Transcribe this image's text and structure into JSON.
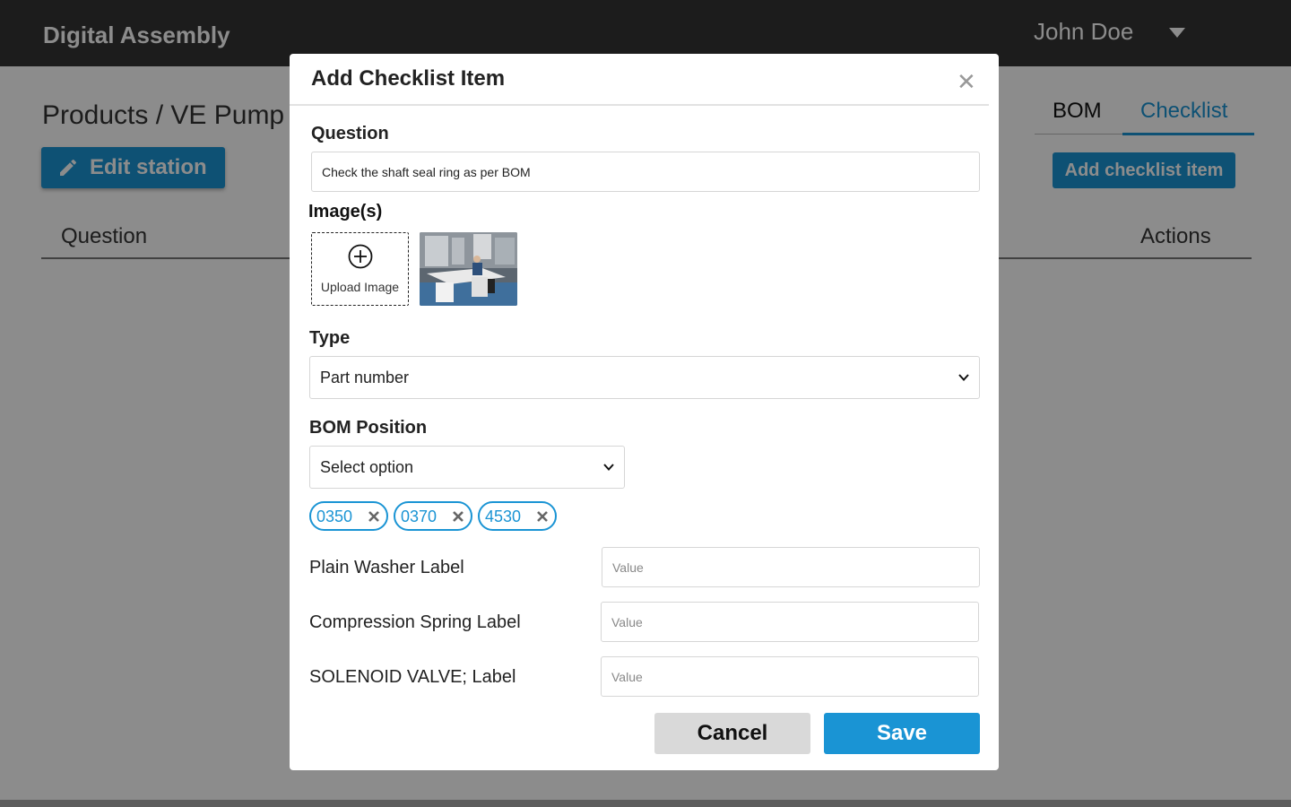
{
  "app": {
    "title": "Digital Assembly",
    "user_name": "John Doe"
  },
  "page": {
    "breadcrumb": "Products / VE Pump",
    "edit_station_label": "Edit station",
    "tabs": [
      {
        "label": "BOM",
        "active": false
      },
      {
        "label": "Checklist",
        "active": true
      }
    ],
    "add_checklist_item_label": "Add checklist item",
    "table_headers": {
      "question": "Question",
      "actions": "Actions"
    }
  },
  "modal": {
    "title": "Add Checklist Item",
    "close_icon": "close-icon",
    "question_label": "Question",
    "question_value": "Check the shaft seal ring as per BOM",
    "images_label": "Image(s)",
    "upload_label": "Upload Image",
    "upload_icon": "plus-circle-icon",
    "type_label": "Type",
    "type_value": "Part number",
    "bom_label": "BOM Position",
    "bom_placeholder": "Select option",
    "bom_chips": [
      {
        "label": "0350"
      },
      {
        "label": "0370"
      },
      {
        "label": "4530"
      }
    ],
    "fields": [
      {
        "label": "Plain Washer Label",
        "placeholder": "Value"
      },
      {
        "label": "Compression Spring Label",
        "placeholder": "Value"
      },
      {
        "label": "SOLENOID VALVE; Label",
        "placeholder": "Value"
      }
    ],
    "cancel_label": "Cancel",
    "save_label": "Save"
  },
  "colors": {
    "accent": "#1a94d4",
    "topbar": "#333333",
    "cancel_bg": "#d9d9d9"
  }
}
